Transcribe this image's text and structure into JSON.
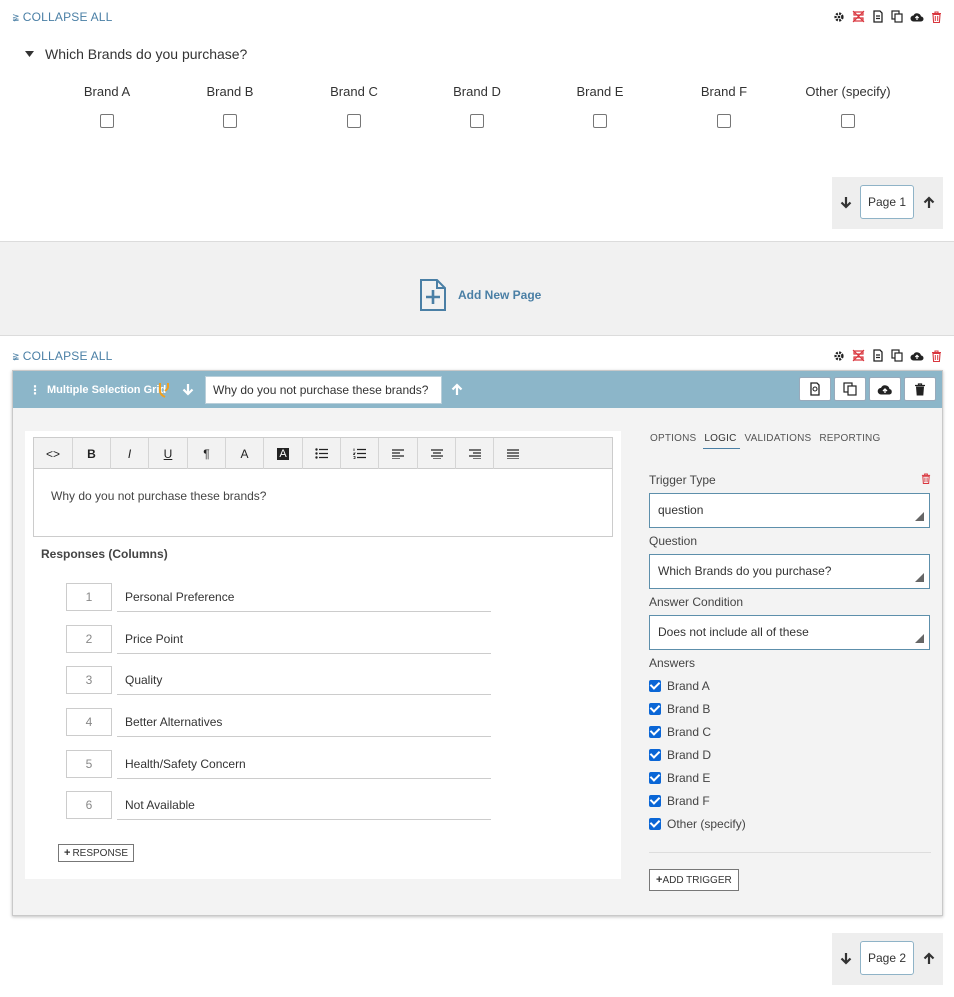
{
  "section1": {
    "collapse_label": "COLLAPSE ALL",
    "question_title": "Which Brands do you purchase?",
    "brands": [
      "Brand A",
      "Brand B",
      "Brand C",
      "Brand D",
      "Brand E",
      "Brand F",
      "Other (specify)"
    ],
    "page_label": "Page 1"
  },
  "add_page": {
    "label": "Add New Page"
  },
  "section2": {
    "collapse_label": "COLLAPSE ALL",
    "question_type": "Multiple Selection Grid",
    "question_text_value": "Why do you not purchase these brands?",
    "editor": {
      "toolbar": [
        "<>",
        "B",
        "I",
        "U",
        "¶",
        "A",
        "A"
      ],
      "content": "Why do you not purchase these brands?"
    },
    "responses_title": "Responses (Columns)",
    "responses": [
      {
        "num": "1",
        "label": "Personal Preference"
      },
      {
        "num": "2",
        "label": "Price Point"
      },
      {
        "num": "3",
        "label": "Quality"
      },
      {
        "num": "4",
        "label": "Better Alternatives"
      },
      {
        "num": "5",
        "label": "Health/Safety Concern"
      },
      {
        "num": "6",
        "label": "Not Available"
      }
    ],
    "add_response_label": "RESPONSE",
    "logic": {
      "tabs": [
        "OPTIONS",
        "LOGIC",
        "VALIDATIONS",
        "REPORTING"
      ],
      "active_tab": "LOGIC",
      "trigger_type_label": "Trigger Type",
      "trigger_type_value": "question",
      "question_label": "Question",
      "question_value": "Which Brands do you purchase?",
      "answer_condition_label": "Answer Condition",
      "answer_condition_value": "Does not include all of these",
      "answers_label": "Answers",
      "answers": [
        "Brand A",
        "Brand B",
        "Brand C",
        "Brand D",
        "Brand E",
        "Brand F",
        "Other (specify)"
      ],
      "add_trigger_label": "ADD TRIGGER"
    },
    "page_label": "Page 2"
  },
  "colors": {
    "accent": "#4a7fa5",
    "header_bar": "#8cb6c9",
    "delete_red": "#d9363e",
    "checkbox_blue": "#0a66d6"
  }
}
